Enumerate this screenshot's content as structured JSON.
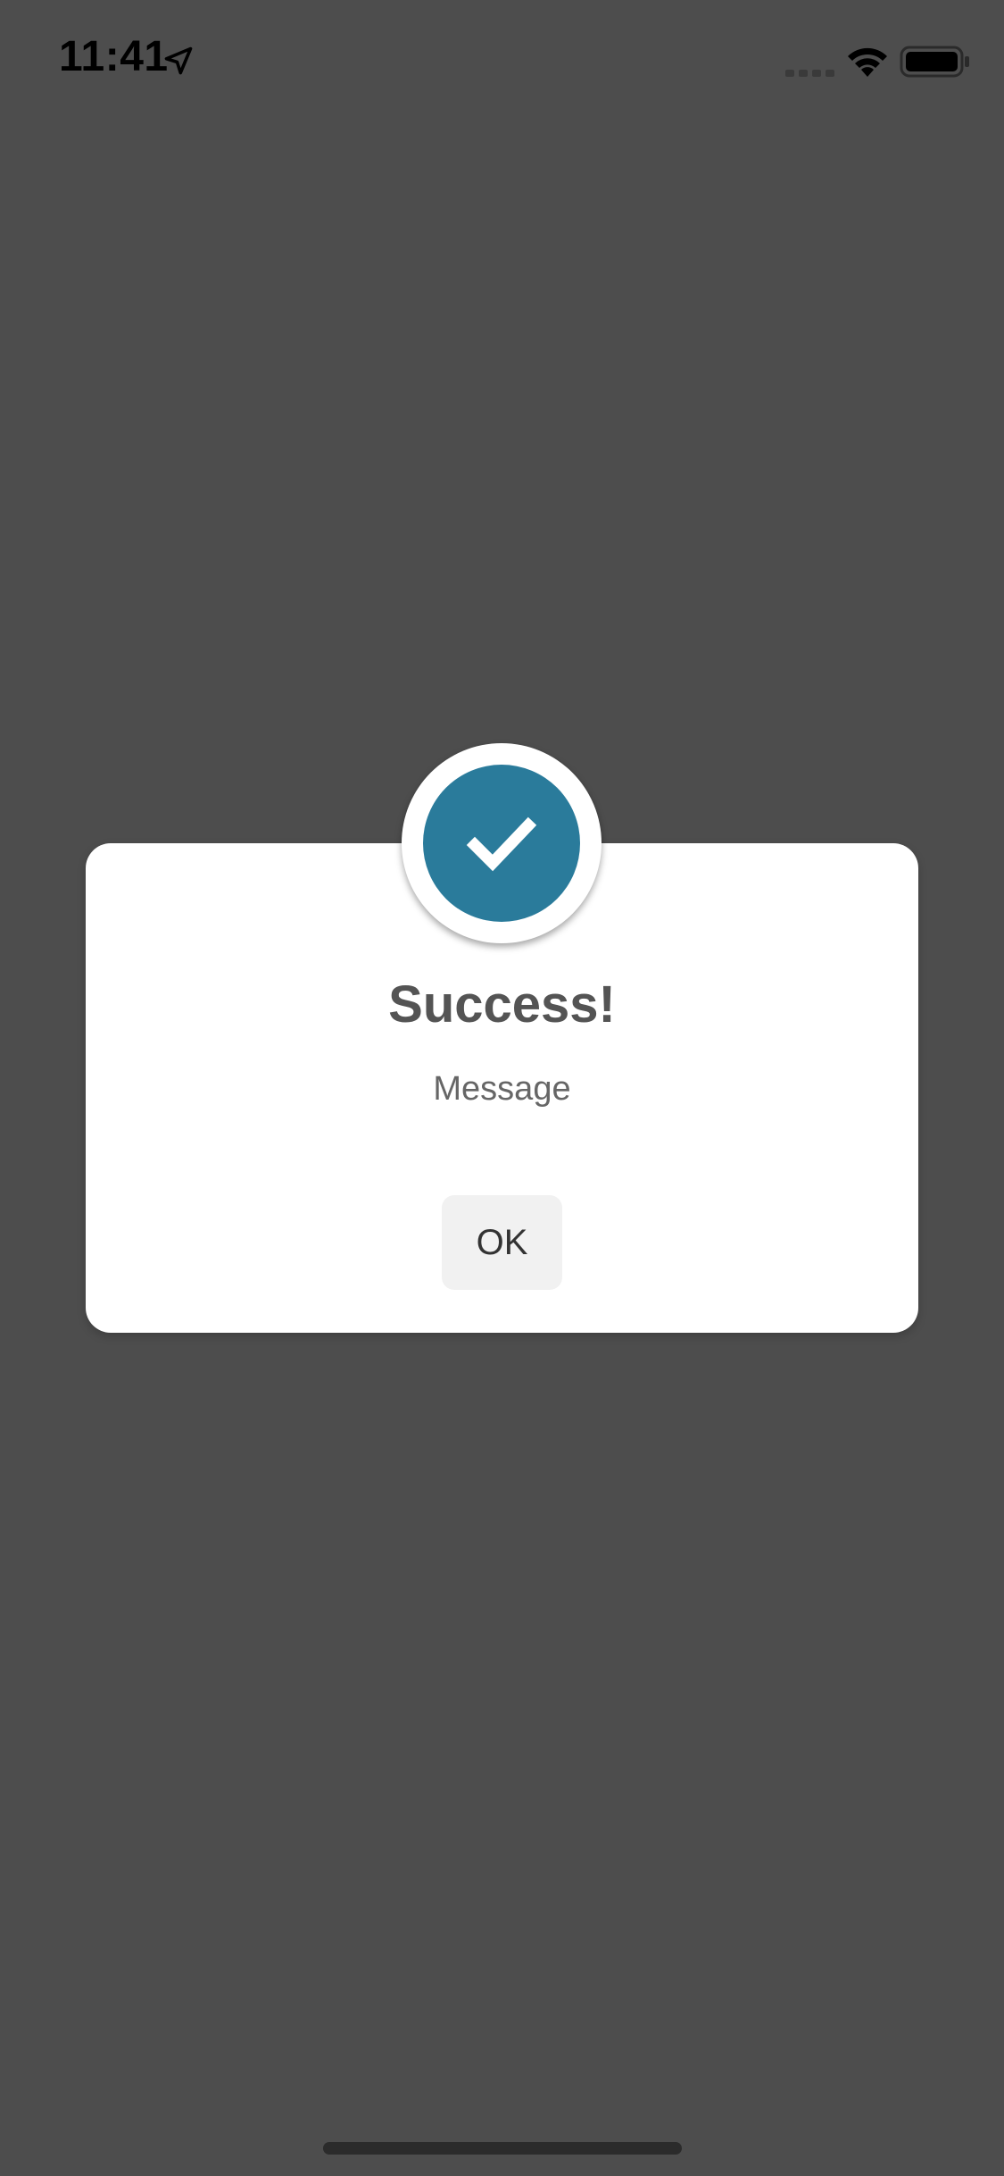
{
  "status_bar": {
    "time": "11:41",
    "icons": [
      "location-arrow-icon",
      "cellular-signal-icon",
      "wifi-icon",
      "battery-icon"
    ]
  },
  "dialog": {
    "icon": "checkmark-icon",
    "accent_color": "#2a7b9b",
    "title": "Success!",
    "message": "Message",
    "ok_label": "OK"
  },
  "colors": {
    "overlay_background": "#4d4d4d",
    "card_background": "#ffffff",
    "button_background": "#f1f1f1"
  }
}
